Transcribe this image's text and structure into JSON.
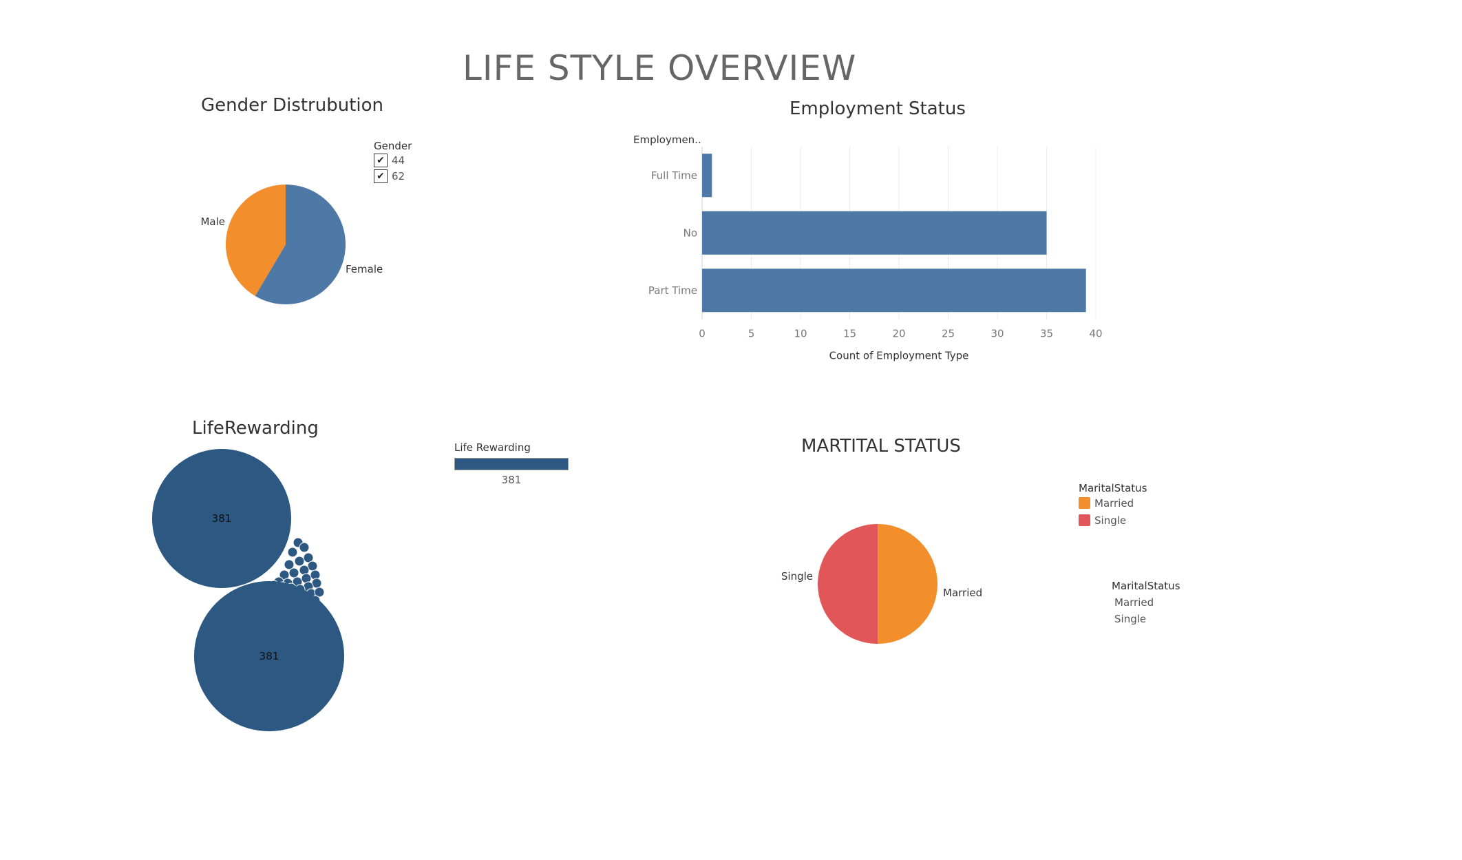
{
  "dashboard": {
    "title": "LIFE STYLE OVERVIEW"
  },
  "gender": {
    "title": "Gender Distrubution",
    "legend_title": "Gender",
    "legend_items": [
      {
        "label": "44",
        "checked": true
      },
      {
        "label": "62",
        "checked": true
      }
    ],
    "icons": {
      "checkbox": "check-icon"
    }
  },
  "employment": {
    "title": "Employment Status",
    "row_header": "Employmen.."
  },
  "life_rewarding": {
    "title": "LifeRewarding",
    "legend_title": "Life Rewarding",
    "legend_value": "381",
    "colors": {
      "bubble": "#2c5882"
    }
  },
  "marital": {
    "title": "MARTITAL STATUS",
    "legend_title": "MaritalStatus",
    "legend_items": [
      {
        "label": "Married",
        "color": "#f28e2b"
      },
      {
        "label": "Single",
        "color": "#e15759"
      }
    ],
    "text_legend_title": "MaritalStatus",
    "text_legend_items": [
      "Married",
      "Single"
    ]
  },
  "chart_data": [
    {
      "id": "gender",
      "type": "pie",
      "title": "Gender Distrubution",
      "labels": [
        "Female",
        "Male"
      ],
      "values": [
        58.5,
        41.5
      ],
      "colors": [
        "#4e79a7",
        "#f28e2b"
      ]
    },
    {
      "id": "employment",
      "type": "bar",
      "orientation": "horizontal",
      "title": "Employment Status",
      "categories": [
        "Full Time",
        "No",
        "Part Time"
      ],
      "values": [
        1,
        35,
        39
      ],
      "xlabel": "Count of Employment Type",
      "ylabel": "Employmen..",
      "xlim": [
        0,
        40
      ],
      "xticks": [
        "0",
        "5",
        "10",
        "15",
        "20",
        "25",
        "30",
        "35",
        "40"
      ],
      "grid": true,
      "color": "#4e79a7"
    },
    {
      "id": "life_rewarding",
      "type": "scatter",
      "title": "LifeRewarding",
      "series": [
        {
          "name": "Life Rewarding",
          "values": [
            381,
            381
          ]
        }
      ],
      "point_labels": [
        "381",
        "381"
      ],
      "color": "#2c5882"
    },
    {
      "id": "marital",
      "type": "pie",
      "title": "MARTITAL STATUS",
      "labels": [
        "Married",
        "Single"
      ],
      "values": [
        50,
        50
      ],
      "colors": [
        "#f28e2b",
        "#e15759"
      ]
    }
  ]
}
